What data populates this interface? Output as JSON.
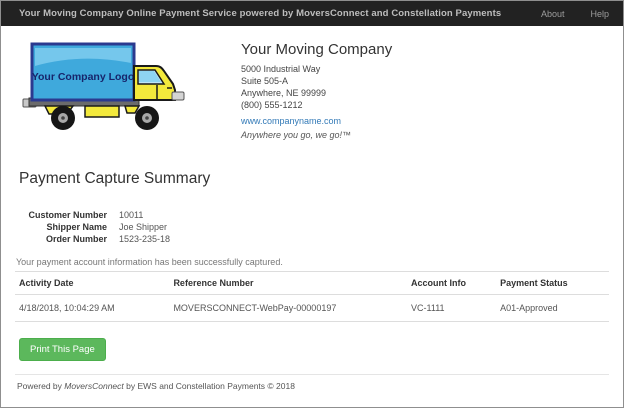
{
  "navbar": {
    "brand": "Your Moving Company Online Payment Service powered by MoversConnect and Constellation Payments",
    "about_label": "About",
    "help_label": "Help"
  },
  "company": {
    "logo_text": "Your Company Logo",
    "name": "Your Moving Company",
    "address_line1": "5000 Industrial Way",
    "address_line2": "Suite 505-A",
    "address_line3": "Anywhere, NE 99999",
    "phone": "(800) 555-1212",
    "website": "www.companyname.com",
    "tagline": "Anywhere you go, we go!™"
  },
  "page": {
    "title": "Payment Capture Summary"
  },
  "details": {
    "rows": [
      {
        "label": "Customer Number",
        "value": "10011"
      },
      {
        "label": "Shipper Name",
        "value": "Joe Shipper"
      },
      {
        "label": "Order Number",
        "value": "1523-235-18"
      }
    ]
  },
  "status_message": "Your payment account information has been successfully captured.",
  "activity_table": {
    "headers": [
      "Activity Date",
      "Reference Number",
      "Account Info",
      "Payment Status"
    ],
    "rows": [
      [
        "4/18/2018, 10:04:29 AM",
        "MOVERSCONNECT-WebPay-00000197",
        "VC-1111",
        "A01-Approved"
      ]
    ]
  },
  "actions": {
    "print_label": "Print This Page"
  },
  "footer": {
    "prefix": "Powered by ",
    "brand": "MoversConnect",
    "suffix": " by EWS and Constellation Payments © 2018"
  },
  "colors": {
    "navbar_bg": "#222222",
    "link_blue": "#337ab7",
    "button_green": "#5cb85c",
    "truck_box_blue": "#3fa9dc",
    "truck_cab_yellow": "#f3e93c"
  }
}
